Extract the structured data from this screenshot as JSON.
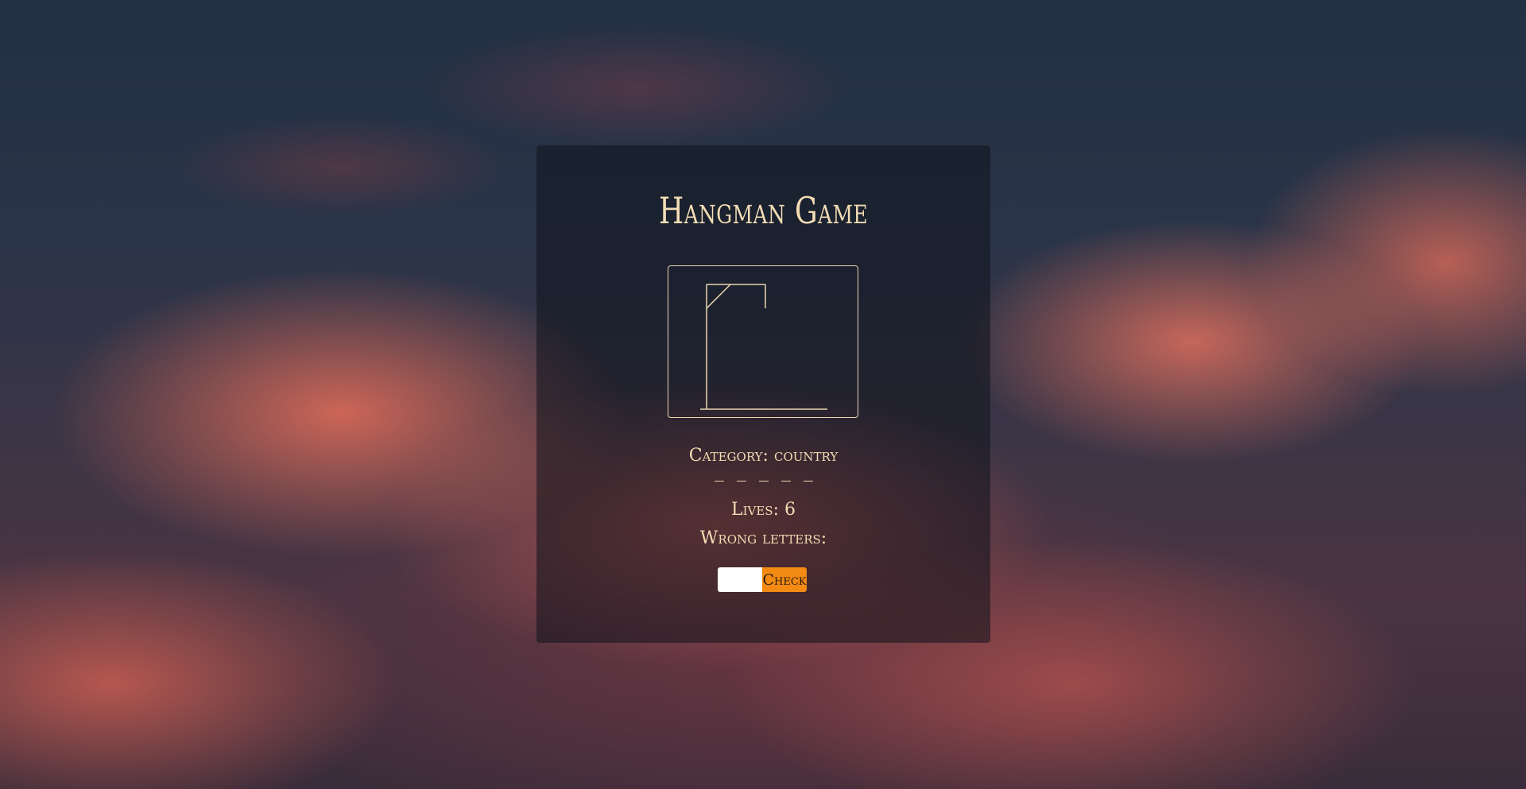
{
  "game": {
    "title": "Hangman Game",
    "category_label": "Category:",
    "category_value": "country",
    "word_slots": 5,
    "lives_label": "Lives:",
    "lives_value": "6",
    "wrong_letters_label": "Wrong letters:",
    "wrong_letters_value": "",
    "input_value": "",
    "check_button_label": "Check"
  },
  "colors": {
    "text": "#f2dcb4",
    "accent_button": "#f28a14",
    "panel": "rgba(15,18,28,0.55)"
  }
}
